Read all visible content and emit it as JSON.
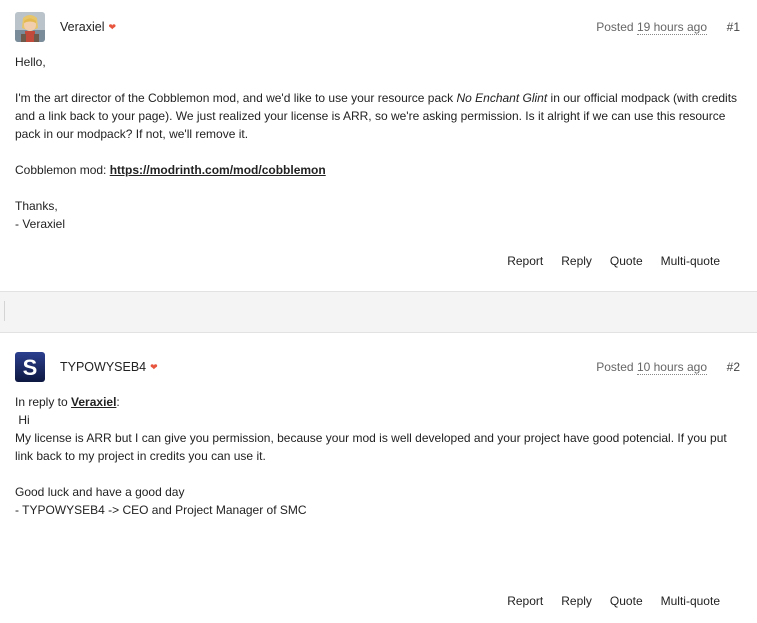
{
  "posts": [
    {
      "username": "Veraxiel",
      "posted_label": "Posted",
      "posted_time": "19 hours ago",
      "number": "#1",
      "greeting": "Hello,",
      "para1_a": "I'm the art director of the Cobblemon mod, and we'd like to use your resource pack ",
      "para1_em": "No Enchant Glint",
      "para1_b": " in our official modpack (with credits and a link back to your page). We just realized your license is ARR, so we're asking permission. Is it alright if we can use this resource pack in our modpack? If not, we'll remove it.",
      "mod_label": "Cobblemon mod: ",
      "mod_link": "https://modrinth.com/mod/cobblemon",
      "thanks": "Thanks,",
      "signature": "- Veraxiel",
      "actions": [
        "Report",
        "Reply",
        "Quote",
        "Multi-quote"
      ]
    },
    {
      "username": "TYPOWYSEB4",
      "posted_label": "Posted",
      "posted_time": "10 hours ago",
      "number": "#2",
      "reply_prefix": "In reply to ",
      "reply_user": "Veraxiel",
      "reply_suffix": ":",
      "hi": "Hi",
      "para1": "My license is ARR but I can give you permission, because your mod is well developed and your project have good potencial. If you put link back to my project in credits you can use it.",
      "goodluck": "Good luck and have a good day",
      "signature": "- TYPOWYSEB4 -> CEO and Project Manager of SMC",
      "actions": [
        "Report",
        "Reply",
        "Quote",
        "Multi-quote"
      ]
    }
  ],
  "icons": {
    "heart": "heart-icon",
    "avatar1": "anime-character-avatar",
    "avatar2": "s-letter-avatar"
  },
  "colors": {
    "heart": "#e8553e",
    "avatar2_bg": "#1a2a6c"
  }
}
